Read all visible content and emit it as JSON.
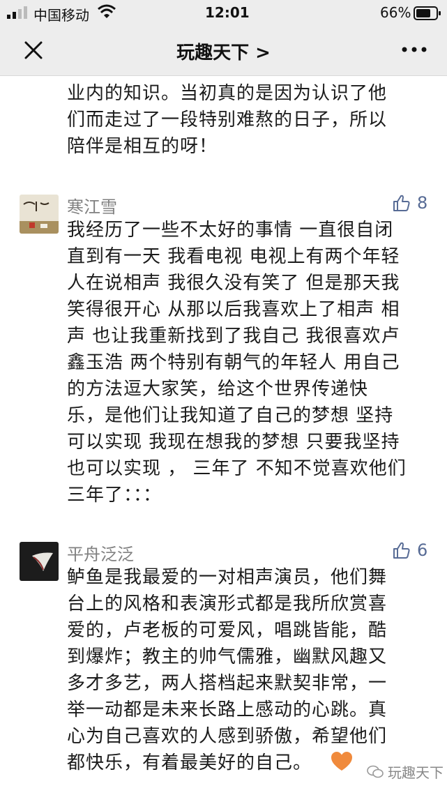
{
  "status_bar": {
    "carrier": "中国移动",
    "time": "12:01",
    "battery": "66%"
  },
  "nav": {
    "title": "玩趣天下 >",
    "close_icon": "close-icon",
    "more_icon": "more-icon"
  },
  "top_text": "业内的知识。当初真的是因为认识了他\n们而走过了一段特别难熬的日子，所以\n陪伴是相互的呀！",
  "comments": [
    {
      "author": "寒江雪",
      "likes": "8",
      "text": "我经历了一些不太好的事情 一直很自闭\n直到有一天 我看电视 电视上有两个年轻\n人在说相声 我很久没有笑了 但是那天我\n笑得很开心 从那以后我喜欢上了相声 相\n声 也让我重新找到了我自己 我很喜欢卢\n鑫玉浩 两个特别有朝气的年轻人 用自己\n的方法逗大家笑，给这个世界传递快\n乐，是他们让我知道了自己的梦想 坚持\n可以实现 我现在想我的梦想 只要我坚持\n也可以实现 ， 三年了 不知不觉喜欢他们\n三年了：：："
    },
    {
      "author": "平舟泛泛",
      "likes": "6",
      "text": "鲈鱼是我最爱的一对相声演员，他们舞\n台上的风格和表演形式都是我所欣赏喜\n爱的，卢老板的可爱风，唱跳皆能，酷\n到爆炸；教主的帅气儒雅，幽默风趣又\n多才多艺，两人搭档起来默契非常，一\n举一动都是未来长路上感动的心跳。真\n心为自己喜欢的人感到骄傲，希望他们\n都快乐，有着最美好的自己。"
    }
  ],
  "watermark": "玩趣天下",
  "colors": {
    "bar_bg": "#ededed",
    "link": "#576b95",
    "author": "#808080",
    "heart": "#f08a3c"
  }
}
